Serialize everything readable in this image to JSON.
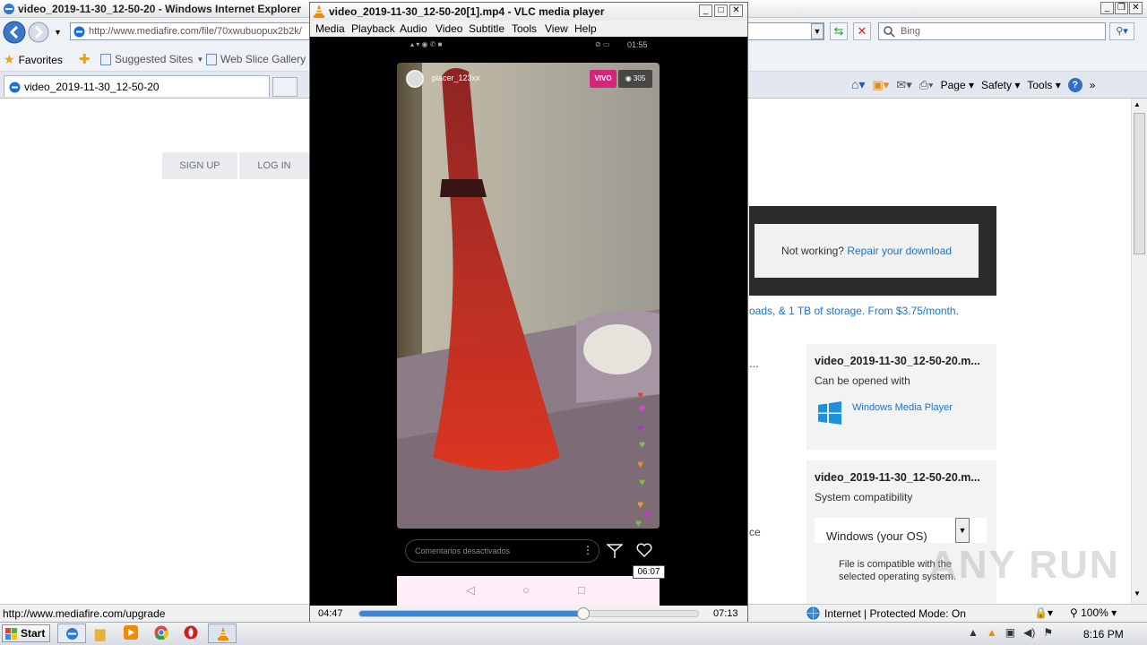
{
  "ie": {
    "title": "video_2019-11-30_12-50-20 - Windows Internet Explorer",
    "url": "http://www.mediafire.com/file/70xwubuopux2b2k/",
    "search_placeholder": "Bing",
    "favorites_label": "Favorites",
    "suggested_sites": "Suggested Sites",
    "web_slice": "Web Slice Gallery",
    "tab_title": "video_2019-11-30_12-50-20",
    "cmd_page": "Page",
    "cmd_safety": "Safety",
    "cmd_tools": "Tools",
    "status_url": "http://www.mediafire.com/upgrade",
    "status_zone": "Internet | Protected Mode: On",
    "zoom": "100%"
  },
  "mediafire": {
    "signup": "SIGN UP",
    "login": "LOG IN",
    "not_working": "Not working?",
    "repair": "Repair your download",
    "storage_text": "oads, & 1 TB of storage. From $3.75/month.",
    "ellipsis": "...",
    "ce_text": "ce",
    "card1": {
      "title": "video_2019-11-30_12-50-20.m...",
      "subtitle": "Can be opened with",
      "app": "Windows Media Player"
    },
    "card2": {
      "title": "video_2019-11-30_12-50-20.m...",
      "subtitle": "System compatibility",
      "os_select": "Windows (your OS)",
      "compat_line1": "File is compatible with the",
      "compat_line2": "selected operating system."
    }
  },
  "vlc": {
    "title": "video_2019-11-30_12-50-20[1].mp4 - VLC media player",
    "menu": [
      "Media",
      "Playback",
      "Audio",
      "Video",
      "Subtitle",
      "Tools",
      "View",
      "Help"
    ],
    "elapsed": "04:47",
    "total": "07:13",
    "tooltip_time": "06:07",
    "progress": 0.662
  },
  "video": {
    "phone_time": "01:55",
    "username": "placer_123xx",
    "live_badge": "VIVO",
    "viewers": "305",
    "comment_placeholder": "Comentarios desactivados"
  },
  "taskbar": {
    "start": "Start",
    "clock": "8:16 PM"
  },
  "watermark": "ANY RUN",
  "colors": {
    "link": "#1a73c9",
    "live": "#d6247a",
    "progress": "#3c86d8"
  }
}
